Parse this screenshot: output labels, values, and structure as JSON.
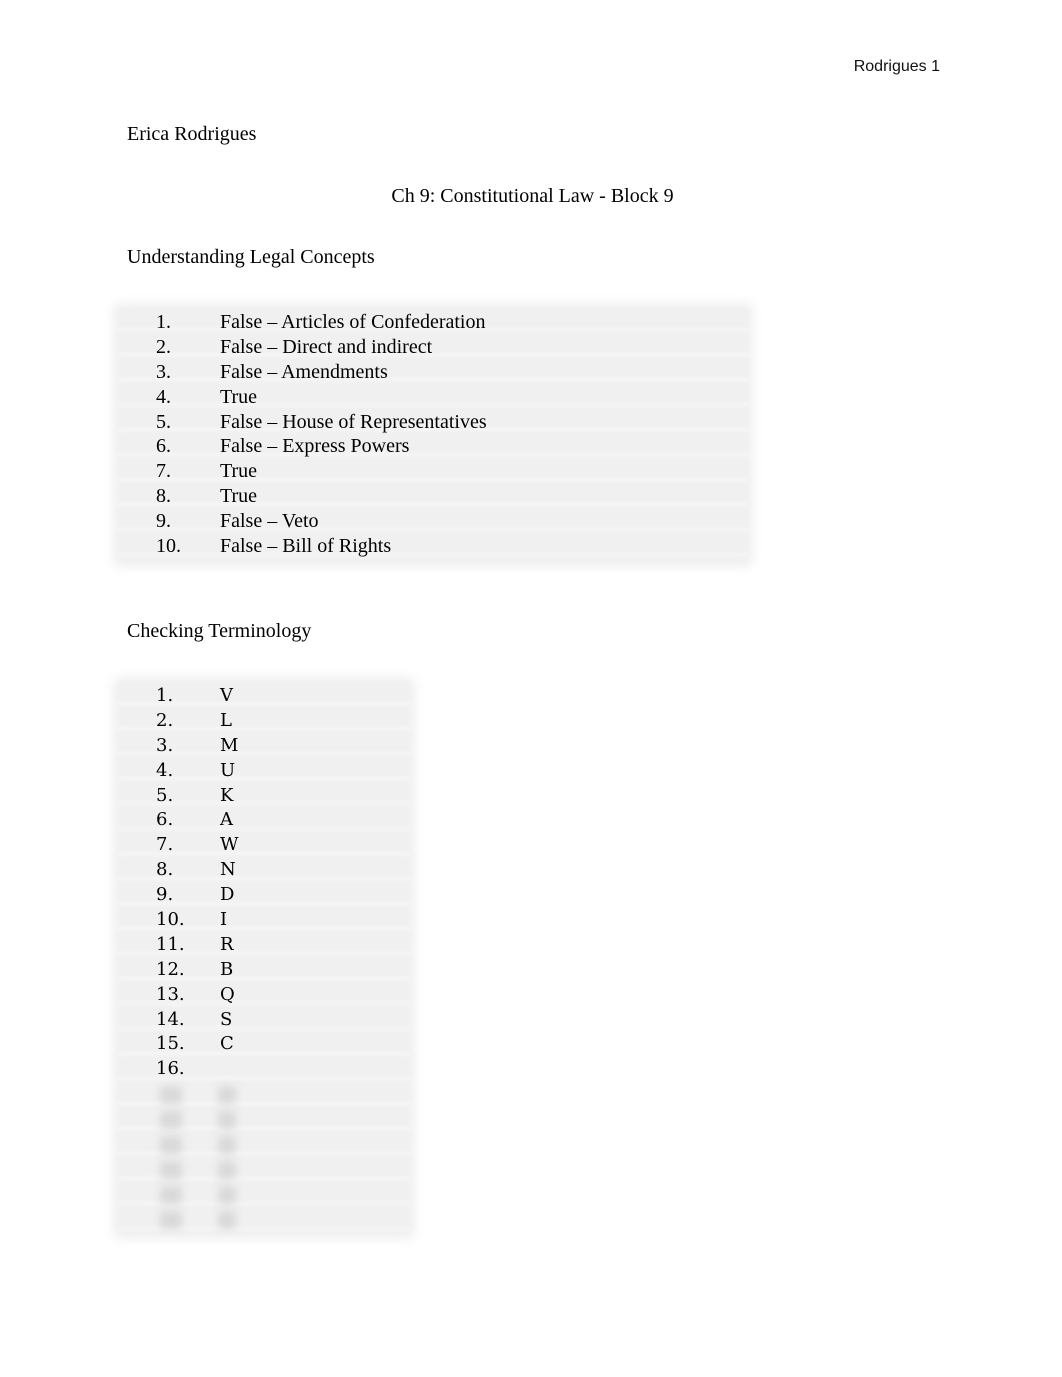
{
  "header": {
    "page_label": "Rodrigues 1"
  },
  "document": {
    "author": "Erica Rodrigues",
    "title": "Ch 9: Constitutional Law - Block 9",
    "sections": [
      {
        "heading": "Understanding Legal Concepts",
        "items": [
          {
            "num": "1.",
            "answer": "False – Articles of Confederation"
          },
          {
            "num": "2.",
            "answer": "False – Direct and indirect"
          },
          {
            "num": "3.",
            "answer": "False – Amendments"
          },
          {
            "num": "4.",
            "answer": "True"
          },
          {
            "num": "5.",
            "answer": "False – House of Representatives"
          },
          {
            "num": "6.",
            "answer": "False – Express Powers"
          },
          {
            "num": "7.",
            "answer": "True"
          },
          {
            "num": "8.",
            "answer": "True"
          },
          {
            "num": "9.",
            "answer": "False – Veto"
          },
          {
            "num": "10.",
            "answer": "False – Bill of Rights"
          }
        ]
      },
      {
        "heading": "Checking Terminology",
        "items": [
          {
            "num": "1.",
            "answer": "V"
          },
          {
            "num": "2.",
            "answer": "L"
          },
          {
            "num": "3.",
            "answer": "M"
          },
          {
            "num": "4.",
            "answer": "U"
          },
          {
            "num": "5.",
            "answer": "K"
          },
          {
            "num": "6.",
            "answer": "A"
          },
          {
            "num": "7.",
            "answer": "W"
          },
          {
            "num": "8.",
            "answer": "N"
          },
          {
            "num": "9.",
            "answer": "D"
          },
          {
            "num": "10.",
            "answer": "I"
          },
          {
            "num": "11.",
            "answer": "R"
          },
          {
            "num": "12.",
            "answer": "B"
          },
          {
            "num": "13.",
            "answer": "Q"
          },
          {
            "num": "14.",
            "answer": "S"
          },
          {
            "num": "15.",
            "answer": "C"
          },
          {
            "num": "16.",
            "answer": ""
          }
        ],
        "blurred_rows_hidden": 6
      }
    ]
  }
}
